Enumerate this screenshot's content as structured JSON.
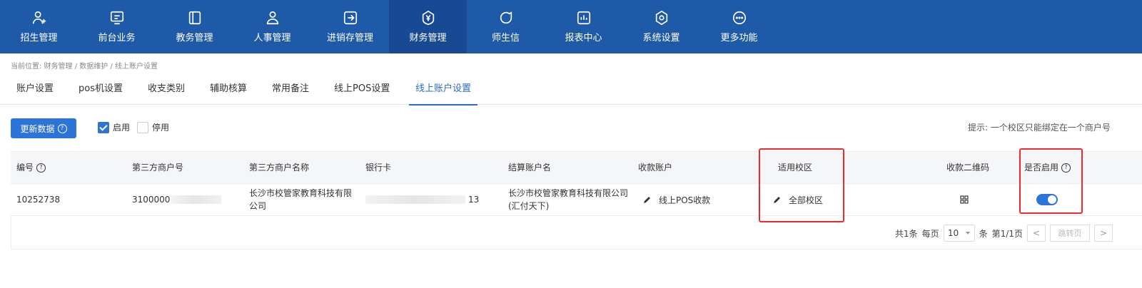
{
  "nav": [
    {
      "label": "招生管理",
      "icon": "person-add-icon"
    },
    {
      "label": "前台业务",
      "icon": "monitor-icon"
    },
    {
      "label": "教务管理",
      "icon": "book-icon"
    },
    {
      "label": "人事管理",
      "icon": "person-icon"
    },
    {
      "label": "进销存管理",
      "icon": "login-box-icon"
    },
    {
      "label": "财务管理",
      "icon": "yen-shield-icon",
      "active": true
    },
    {
      "label": "师生信",
      "icon": "chat-icon"
    },
    {
      "label": "报表中心",
      "icon": "bar-chart-icon"
    },
    {
      "label": "系统设置",
      "icon": "settings-icon"
    },
    {
      "label": "更多功能",
      "icon": "more-icon"
    }
  ],
  "breadcrumb": "当前位置: 财务管理 / 数据维护 / 线上账户设置",
  "tabs": [
    "账户设置",
    "pos机设置",
    "收支类别",
    "辅助核算",
    "常用备注",
    "线上POS设置",
    "线上账户设置"
  ],
  "toolbar": {
    "refresh_label": "更新数据",
    "enabled_label": "启用",
    "disabled_label": "停用",
    "hint": "提示: 一个校区只能绑定在一个商户号"
  },
  "table": {
    "headers": [
      "编号",
      "第三方商户号",
      "第三方商户名称",
      "银行卡",
      "结算账户名",
      "收款账户",
      "适用校区",
      "收款二维码",
      "是否启用"
    ],
    "rows": [
      {
        "id": "10252738",
        "merchant_no": "3100000",
        "merchant_name": "长沙市校管家教育科技有限公司",
        "bank_card_tail": "13",
        "settle_name": "长沙市校管家教育科技有限公司(汇付天下)",
        "account": "线上POS收款",
        "campus": "全部校区",
        "enabled": true
      }
    ]
  },
  "pager": {
    "total": "共1条",
    "per_page_label": "每页",
    "per_page": "10",
    "unit": "条",
    "page": "第1/1页",
    "prev": "<",
    "jump": "跳转页",
    "next": ">"
  }
}
